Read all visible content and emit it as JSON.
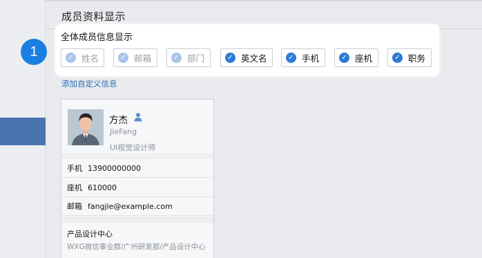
{
  "page": {
    "title": "成员资料显示"
  },
  "step": {
    "number": "1"
  },
  "field_panel": {
    "heading": "全体成员信息显示",
    "fields": [
      {
        "label": "姓名",
        "checked": true,
        "disabled": true
      },
      {
        "label": "邮箱",
        "checked": true,
        "disabled": true
      },
      {
        "label": "部门",
        "checked": true,
        "disabled": true
      },
      {
        "label": "英文名",
        "checked": true,
        "disabled": false
      },
      {
        "label": "手机",
        "checked": true,
        "disabled": false
      },
      {
        "label": "座机",
        "checked": true,
        "disabled": false
      },
      {
        "label": "职务",
        "checked": true,
        "disabled": false
      }
    ]
  },
  "add_custom": {
    "label": "添加自定义信息"
  },
  "profile_card": {
    "name": "方杰",
    "english_name": "JieFang",
    "position": "UI视觉设计师",
    "mobile_label": "手机",
    "mobile_value": "13900000000",
    "phone_label": "座机",
    "phone_value": "610000",
    "email_label": "邮箱",
    "email_value": "fangjie@example.com",
    "department": "产品设计中心",
    "department_path": "WXG微信事业群/广州研发部/产品设计中心"
  },
  "colors": {
    "accent": "#1a7fe0",
    "checked": "#2f7ad8",
    "checked_disabled": "#a9c4e6",
    "link": "#2d6bb5",
    "sidebar_active": "#4a74b0"
  }
}
